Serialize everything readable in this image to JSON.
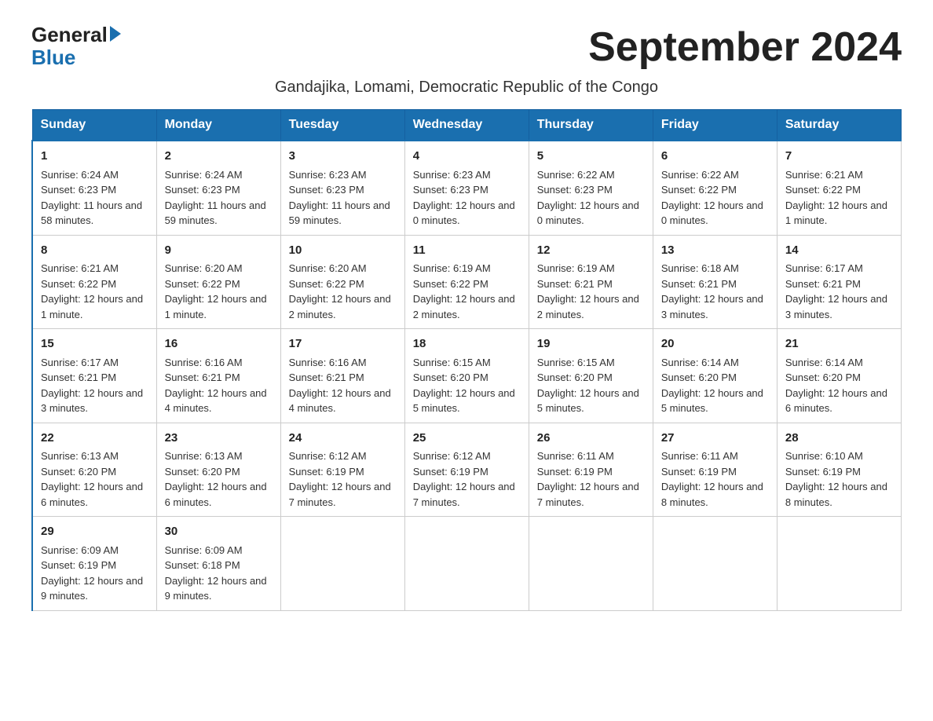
{
  "header": {
    "logo_general": "General",
    "logo_blue": "Blue",
    "month_title": "September 2024",
    "location": "Gandajika, Lomami, Democratic Republic of the Congo"
  },
  "days_of_week": [
    "Sunday",
    "Monday",
    "Tuesday",
    "Wednesday",
    "Thursday",
    "Friday",
    "Saturday"
  ],
  "weeks": [
    [
      {
        "day": "1",
        "sunrise": "6:24 AM",
        "sunset": "6:23 PM",
        "daylight": "11 hours and 58 minutes."
      },
      {
        "day": "2",
        "sunrise": "6:24 AM",
        "sunset": "6:23 PM",
        "daylight": "11 hours and 59 minutes."
      },
      {
        "day": "3",
        "sunrise": "6:23 AM",
        "sunset": "6:23 PM",
        "daylight": "11 hours and 59 minutes."
      },
      {
        "day": "4",
        "sunrise": "6:23 AM",
        "sunset": "6:23 PM",
        "daylight": "12 hours and 0 minutes."
      },
      {
        "day": "5",
        "sunrise": "6:22 AM",
        "sunset": "6:23 PM",
        "daylight": "12 hours and 0 minutes."
      },
      {
        "day": "6",
        "sunrise": "6:22 AM",
        "sunset": "6:22 PM",
        "daylight": "12 hours and 0 minutes."
      },
      {
        "day": "7",
        "sunrise": "6:21 AM",
        "sunset": "6:22 PM",
        "daylight": "12 hours and 1 minute."
      }
    ],
    [
      {
        "day": "8",
        "sunrise": "6:21 AM",
        "sunset": "6:22 PM",
        "daylight": "12 hours and 1 minute."
      },
      {
        "day": "9",
        "sunrise": "6:20 AM",
        "sunset": "6:22 PM",
        "daylight": "12 hours and 1 minute."
      },
      {
        "day": "10",
        "sunrise": "6:20 AM",
        "sunset": "6:22 PM",
        "daylight": "12 hours and 2 minutes."
      },
      {
        "day": "11",
        "sunrise": "6:19 AM",
        "sunset": "6:22 PM",
        "daylight": "12 hours and 2 minutes."
      },
      {
        "day": "12",
        "sunrise": "6:19 AM",
        "sunset": "6:21 PM",
        "daylight": "12 hours and 2 minutes."
      },
      {
        "day": "13",
        "sunrise": "6:18 AM",
        "sunset": "6:21 PM",
        "daylight": "12 hours and 3 minutes."
      },
      {
        "day": "14",
        "sunrise": "6:17 AM",
        "sunset": "6:21 PM",
        "daylight": "12 hours and 3 minutes."
      }
    ],
    [
      {
        "day": "15",
        "sunrise": "6:17 AM",
        "sunset": "6:21 PM",
        "daylight": "12 hours and 3 minutes."
      },
      {
        "day": "16",
        "sunrise": "6:16 AM",
        "sunset": "6:21 PM",
        "daylight": "12 hours and 4 minutes."
      },
      {
        "day": "17",
        "sunrise": "6:16 AM",
        "sunset": "6:21 PM",
        "daylight": "12 hours and 4 minutes."
      },
      {
        "day": "18",
        "sunrise": "6:15 AM",
        "sunset": "6:20 PM",
        "daylight": "12 hours and 5 minutes."
      },
      {
        "day": "19",
        "sunrise": "6:15 AM",
        "sunset": "6:20 PM",
        "daylight": "12 hours and 5 minutes."
      },
      {
        "day": "20",
        "sunrise": "6:14 AM",
        "sunset": "6:20 PM",
        "daylight": "12 hours and 5 minutes."
      },
      {
        "day": "21",
        "sunrise": "6:14 AM",
        "sunset": "6:20 PM",
        "daylight": "12 hours and 6 minutes."
      }
    ],
    [
      {
        "day": "22",
        "sunrise": "6:13 AM",
        "sunset": "6:20 PM",
        "daylight": "12 hours and 6 minutes."
      },
      {
        "day": "23",
        "sunrise": "6:13 AM",
        "sunset": "6:20 PM",
        "daylight": "12 hours and 6 minutes."
      },
      {
        "day": "24",
        "sunrise": "6:12 AM",
        "sunset": "6:19 PM",
        "daylight": "12 hours and 7 minutes."
      },
      {
        "day": "25",
        "sunrise": "6:12 AM",
        "sunset": "6:19 PM",
        "daylight": "12 hours and 7 minutes."
      },
      {
        "day": "26",
        "sunrise": "6:11 AM",
        "sunset": "6:19 PM",
        "daylight": "12 hours and 7 minutes."
      },
      {
        "day": "27",
        "sunrise": "6:11 AM",
        "sunset": "6:19 PM",
        "daylight": "12 hours and 8 minutes."
      },
      {
        "day": "28",
        "sunrise": "6:10 AM",
        "sunset": "6:19 PM",
        "daylight": "12 hours and 8 minutes."
      }
    ],
    [
      {
        "day": "29",
        "sunrise": "6:09 AM",
        "sunset": "6:19 PM",
        "daylight": "12 hours and 9 minutes."
      },
      {
        "day": "30",
        "sunrise": "6:09 AM",
        "sunset": "6:18 PM",
        "daylight": "12 hours and 9 minutes."
      },
      null,
      null,
      null,
      null,
      null
    ]
  ],
  "labels": {
    "sunrise_prefix": "Sunrise: ",
    "sunset_prefix": "Sunset: ",
    "daylight_prefix": "Daylight: "
  }
}
